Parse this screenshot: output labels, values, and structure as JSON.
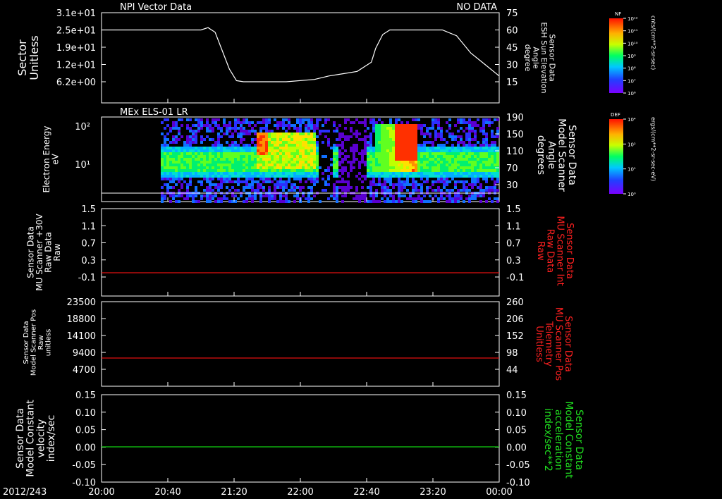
{
  "colors": {
    "background": "#000000",
    "foreground": "#ffffff",
    "red_label": "#ff2020",
    "green_label": "#20e020",
    "red_line": "#e01010",
    "green_line": "#10d010"
  },
  "chart_data": [
    {
      "type": "line",
      "title": "NPI Vector Data",
      "status": "NO DATA",
      "ylabel": "Sector\nUnitless",
      "y_ticks": [
        "3.1e+01",
        "2.5e+01",
        "1.9e+01",
        "1.2e+01",
        "6.2e+00"
      ],
      "y2label": "Sensor Data\nESH Sun Elevation\nAngle\ndegree",
      "y2_ticks": [
        "75",
        "60",
        "45",
        "30",
        "15"
      ],
      "y2lim": [
        5,
        75
      ],
      "series": [
        {
          "x": [
            0,
            60,
            70,
            75,
            80,
            85,
            90,
            95,
            100,
            110,
            120,
            130,
            150,
            160,
            170,
            180,
            190,
            193,
            198,
            203,
            210,
            220,
            230,
            235,
            240,
            250,
            260,
            270,
            280
          ],
          "values": [
            60,
            60,
            60,
            62,
            58,
            42,
            26,
            16,
            15,
            15,
            15,
            15,
            17,
            20,
            22,
            24,
            32,
            44,
            56,
            60,
            60,
            60,
            60,
            60,
            60,
            55,
            40,
            30,
            20
          ]
        }
      ]
    },
    {
      "type": "heatmap",
      "title": "MEx ELS-01 LR",
      "ylabel": "Electron Energy\neV",
      "y_ticks": [
        "10²",
        "10¹"
      ],
      "y2label": "Sensor Data\nModel Scanner\nAngle\ndegrees",
      "y2_ticks": [
        "190",
        "150",
        "110",
        "70",
        "30"
      ],
      "colorbar_label": "DEF",
      "colorbar_ticks": [
        "10⁴",
        "10²",
        "10¹",
        "10⁰"
      ],
      "colorbar_units": "ergs/(cm**2-sr-sec-eV)"
    },
    {
      "type": "line",
      "ylabel": "Sensor Data\nMU Scanner +30V\nRaw Data\nRaw",
      "y_ticks": [
        "1.5",
        "1.1",
        "0.7",
        "0.3",
        "-0.1"
      ],
      "ylim": [
        -0.4,
        1.5
      ],
      "y2label": "Sensor Data\nMU Scanner Int\nRaw Data\nRaw",
      "y2_ticks": [
        "1.5",
        "1.1",
        "0.7",
        "0.3",
        "-0.1"
      ],
      "series": [
        {
          "x": [
            0,
            280
          ],
          "values": [
            0.0,
            0.0
          ]
        }
      ]
    },
    {
      "type": "line",
      "ylabel": "Sensor Data\nModel Scanner Pos\nRaw\nunitless",
      "y_ticks": [
        "23500",
        "18800",
        "14100",
        "9400",
        "4700"
      ],
      "ylim": [
        0,
        23500
      ],
      "y2label": "Sensor Data\nMU Scanner Pos\nTelemetry\nUnitless",
      "y2_ticks": [
        "260",
        "206",
        "152",
        "98",
        "44"
      ],
      "series": [
        {
          "x": [
            0,
            280
          ],
          "values": [
            7800,
            7800
          ]
        }
      ]
    },
    {
      "type": "line",
      "ylabel": "Sensor Data\nModel Constant\nvelocity\nindex/sec",
      "y_ticks": [
        "0.15",
        "0.10",
        "0.05",
        "0.00",
        "-0.05",
        "-0.10"
      ],
      "ylim": [
        -0.1,
        0.15
      ],
      "y2label": "Sensor Data\nModel Constant\nacceleration\nindex/sec**2",
      "y2_ticks": [
        "0.15",
        "0.10",
        "0.05",
        "0.00",
        "-0.05",
        "-0.10"
      ],
      "series": [
        {
          "x": [
            0,
            280
          ],
          "values": [
            0.0,
            0.0
          ]
        }
      ]
    }
  ],
  "colorbar1": {
    "label": "NF",
    "ticks": [
      "10¹²",
      "10¹¹",
      "10¹⁰",
      "10⁹",
      "10⁸",
      "10⁷",
      "10⁶"
    ],
    "units": "cnts/(cm**2-sr-sec)"
  },
  "x_axis": {
    "date": "2012/243",
    "ticks": [
      "20:00",
      "20:40",
      "21:20",
      "22:00",
      "22:40",
      "23:20",
      "00:00"
    ]
  }
}
